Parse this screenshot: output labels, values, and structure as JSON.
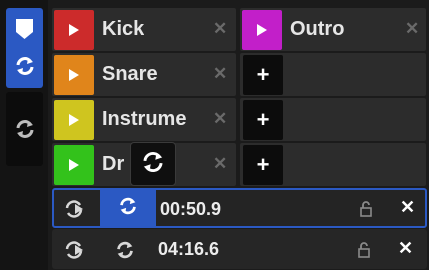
{
  "colors": {
    "accent": "#2b59c3",
    "kick": "#cc2b2b",
    "snare": "#e0851b",
    "instrument": "#cfc51f",
    "drums": "#33c21b",
    "outro": "#c21fc9"
  },
  "pads": [
    {
      "label": "Kick",
      "icon": "play-icon",
      "close": "✕"
    },
    {
      "label": "Snare",
      "icon": "play-icon",
      "close": "✕"
    },
    {
      "label": "Instrume",
      "icon": "play-icon",
      "close": "✕"
    },
    {
      "label": "Dr",
      "icon": "play-icon",
      "close": "✕"
    }
  ],
  "pad_right": {
    "label": "Outro",
    "icon": "play-icon",
    "close": "✕"
  },
  "add_label": "+",
  "loops": [
    {
      "time": "00:50.9",
      "active": true
    },
    {
      "time": "04:16.6",
      "active": false
    }
  ],
  "icons": {
    "sidebar_top": "shield-icon",
    "sidebar_sync": "sync-icon",
    "sidebar_second_sync": "sync-icon",
    "drag_overlay": "sync-icon",
    "lock": "unlock-icon",
    "close": "close-icon"
  },
  "lock_glyph": "⊓",
  "close_glyph": "✕"
}
